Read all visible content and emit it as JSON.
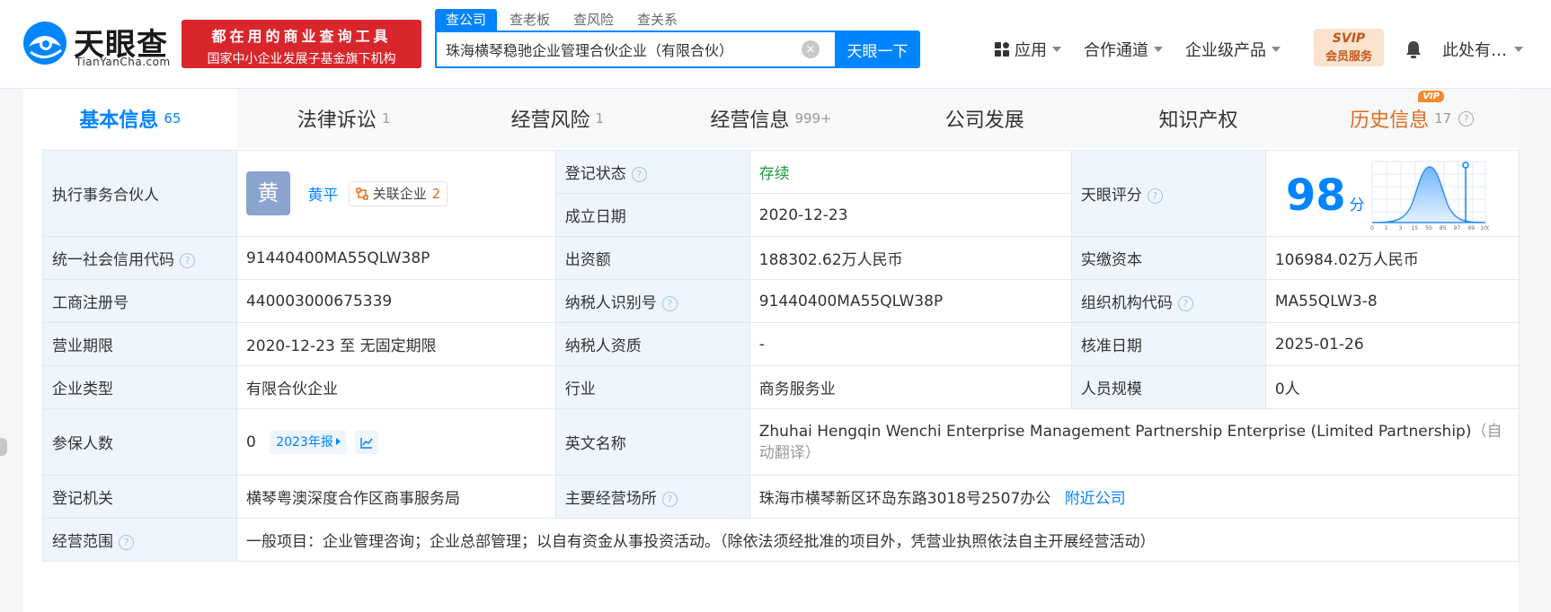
{
  "header": {
    "logo_name": "天眼查",
    "logo_domain": "TianYanCha.com",
    "slogan_line1": "都在用的商业查询工具",
    "slogan_line2": "国家中小企业发展子基金旗下机构",
    "search_tabs": [
      "查公司",
      "查老板",
      "查风险",
      "查关系"
    ],
    "search_value": "珠海横琴稳驰企业管理合伙企业（有限合伙）",
    "search_button": "天眼一下",
    "nav": [
      "应用",
      "合作通道",
      "企业级产品"
    ],
    "vip_line1": "SVIP",
    "vip_line2": "会员服务",
    "user": "此处有…"
  },
  "tabs": [
    {
      "label": "基本信息",
      "count": "65"
    },
    {
      "label": "法律诉讼",
      "count": "1"
    },
    {
      "label": "经营风险",
      "count": "1"
    },
    {
      "label": "经营信息",
      "count": "999+"
    },
    {
      "label": "公司发展",
      "count": ""
    },
    {
      "label": "知识产权",
      "count": ""
    },
    {
      "label": "历史信息",
      "count": "17",
      "badge": "VIP"
    }
  ],
  "info": {
    "partner_label": "执行事务合伙人",
    "partner_avatar": "黄",
    "partner_name": "黄平",
    "related_label": "关联企业",
    "related_count": "2",
    "reg_status_label": "登记状态",
    "reg_status": "存续",
    "found_date_label": "成立日期",
    "found_date": "2020-12-23",
    "score_label": "天眼评分",
    "score": "98",
    "score_unit": "分",
    "score_ticks": [
      "0",
      "1",
      "3",
      "15",
      "50",
      "85",
      "97",
      "99",
      "100"
    ],
    "credit_code_label": "统一社会信用代码",
    "credit_code": "91440400MA55QLW38P",
    "capital_label": "出资额",
    "capital": "188302.62万人民币",
    "paid_capital_label": "实缴资本",
    "paid_capital": "106984.02万人民币",
    "biz_reg_no_label": "工商注册号",
    "biz_reg_no": "440003000675339",
    "taxpayer_id_label": "纳税人识别号",
    "taxpayer_id": "91440400MA55QLW38P",
    "org_code_label": "组织机构代码",
    "org_code": "MA55QLW3-8",
    "term_label": "营业期限",
    "term": "2020-12-23 至 无固定期限",
    "taxpayer_qual_label": "纳税人资质",
    "taxpayer_qual": "-",
    "approve_date_label": "核准日期",
    "approve_date": "2025-01-26",
    "type_label": "企业类型",
    "type": "有限合伙企业",
    "industry_label": "行业",
    "industry": "商务服务业",
    "staff_label": "人员规模",
    "staff": "0人",
    "insured_label": "参保人数",
    "insured": "0",
    "insured_year": "2023年报",
    "en_name_label": "英文名称",
    "en_name": "Zhuhai Hengqin Wenchi Enterprise Management Partnership Enterprise (Limited Partnership)",
    "en_name_note": "（自动翻译）",
    "authority_label": "登记机关",
    "authority": "横琴粤澳深度合作区商事服务局",
    "address_label": "主要经营场所",
    "address": "珠海市横琴新区环岛东路3018号2507办公",
    "nearby": "附近公司",
    "scope_label": "经营范围",
    "scope": "一般项目：企业管理咨询；企业总部管理；以自有资金从事投资活动。（除依法须经批准的项目外，凭营业执照依法自主开展经营活动）"
  },
  "colors": {
    "brand": "#0084ff",
    "slogan_bg": "#d9262c",
    "label_bg": "#eef5fd",
    "status": "#1d9c3d",
    "history": "#e06a1b"
  }
}
